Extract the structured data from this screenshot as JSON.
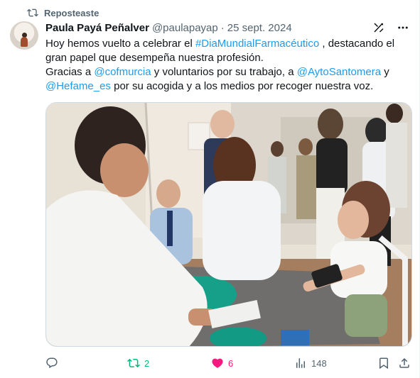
{
  "repost": {
    "label": "Reposteaste",
    "icon": "repost-icon"
  },
  "author": {
    "name": "Paula Payá Peñalver",
    "handle": "@paulapayap",
    "separator": "·",
    "date": "25 sept. 2024",
    "avatar": "avatar-photo"
  },
  "tweet": {
    "line1_prefix": "Hoy hemos vuelto a celebrar el ",
    "hashtag": "#DiaMundialFarmacéutico",
    "line1_suffix": " , destacando el gran papel que desempeña nuestra profesión.",
    "line2_a": "Gracias a ",
    "mention1": "@cofmurcia",
    "line2_b": " y voluntarios por su trabajo, a ",
    "mention2": "@AytoSantomera",
    "line2_c": " y ",
    "mention3": "@Hefame_es",
    "line2_d": " por su acogida y a los medios por recoger nuestra voz."
  },
  "media": {
    "description_icon": "photo",
    "type": "photo"
  },
  "actions": {
    "reply": {
      "icon": "reply-icon",
      "count": ""
    },
    "retweet": {
      "icon": "retweet-icon",
      "count": "2"
    },
    "like": {
      "icon": "heart-filled-icon",
      "count": "6"
    },
    "views": {
      "icon": "views-icon",
      "count": "148"
    },
    "bookmark": {
      "icon": "bookmark-icon"
    },
    "share": {
      "icon": "share-icon"
    }
  },
  "colors": {
    "link": "#1d9bf0",
    "retweet": "#00ba7c",
    "like": "#f91880",
    "muted": "#536471"
  }
}
